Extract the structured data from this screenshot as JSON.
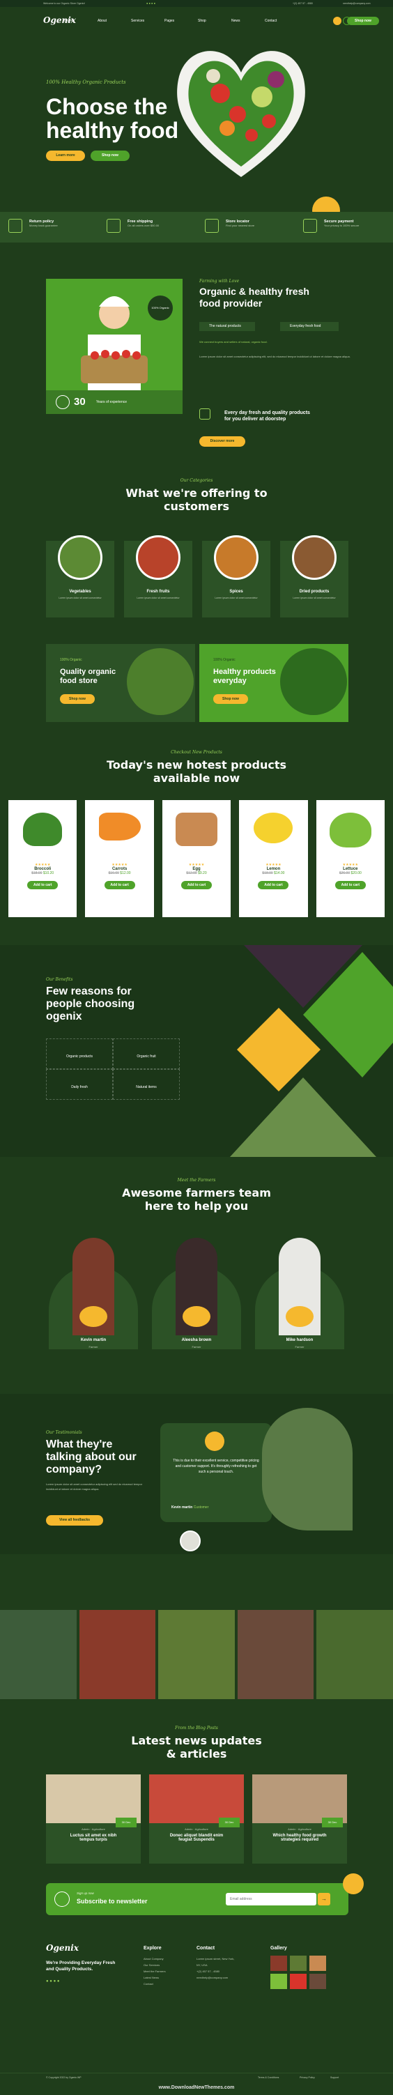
{
  "topbar": {
    "left": "Welcome to our Organic Store Ogenix!",
    "phone": "+(2) 457 57 - 4580",
    "email": "needhelp@company.com"
  },
  "nav": {
    "logo": "Ogenix",
    "items": [
      "Home",
      "About",
      "Services",
      "Pages",
      "Shop",
      "News",
      "Contact"
    ],
    "cta": "Shop now"
  },
  "hero": {
    "kicker": "100% Healthy Organic Products",
    "title1": "Choose the",
    "title2": "healthy food",
    "btn1": "Learn more",
    "btn2": "Shop now"
  },
  "features": [
    {
      "title": "Return policy",
      "text": "Money back guarantee"
    },
    {
      "title": "Free shipping",
      "text": "On all orders over $50.00"
    },
    {
      "title": "Store locator",
      "text": "Find your nearest store"
    },
    {
      "title": "Secure payment",
      "text": "Your privacy is 100% secure"
    }
  ],
  "about": {
    "kicker": "Farming with Love",
    "title1": "Organic & healthy fresh",
    "title2": "food provider",
    "check1": "The natural products",
    "check2": "Everyday fresh food",
    "para1": "We connect buyers and sellers of natural, organic food.",
    "para2": "Lorem ipsum dolor sit amet consectetur adipiscing elit, sed do eiusmod tempor incididunt ut labore et dolore magna aliqua.",
    "delivery1": "Every day fresh and quality products",
    "delivery2": "for you deliver at doorstep",
    "btn": "Discover more",
    "years": "30",
    "years_text": "Years of experience",
    "badge": "100% Organic"
  },
  "categories": {
    "kicker": "Our Categories",
    "title1": "What we're offering to",
    "title2": "customers",
    "items": [
      {
        "name": "Vegetables",
        "text": "Lorem ipsum dolor sit amet consectetur"
      },
      {
        "name": "Fresh fruits",
        "text": "Lorem ipsum dolor sit amet consectetur"
      },
      {
        "name": "Spices",
        "text": "Lorem ipsum dolor sit amet consectetur"
      },
      {
        "name": "Dried products",
        "text": "Lorem ipsum dolor sit amet consectetur"
      }
    ]
  },
  "promo": [
    {
      "kicker": "100% Organic",
      "title1": "Quality organic",
      "title2": "food store",
      "btn": "Shop now"
    },
    {
      "kicker": "100% Organic",
      "title1": "Healthy products",
      "title2": "everyday",
      "btn": "Shop now"
    }
  ],
  "products": {
    "kicker": "Checkout New Products",
    "title1": "Today's new hotest products",
    "title2": "available now",
    "add": "Add to cart",
    "items": [
      {
        "name": "Broccoli",
        "old": "$18.00",
        "price": "$10.20"
      },
      {
        "name": "Carrots",
        "old": "$16.00",
        "price": "$12.00"
      },
      {
        "name": "Egg",
        "old": "$12.00",
        "price": "$9.20"
      },
      {
        "name": "Lemon",
        "old": "$18.00",
        "price": "$14.00"
      },
      {
        "name": "Lettuce",
        "old": "$26.00",
        "price": "$20.00"
      }
    ]
  },
  "reasons": {
    "kicker": "Our Benefits",
    "title1": "Few reasons for",
    "title2": "people choosing",
    "title3": "ogenix",
    "items": [
      "Organic products",
      "Organic fruit",
      "Daily fresh",
      "Natural items"
    ]
  },
  "team": {
    "kicker": "Meet the Farmers",
    "title1": "Awesome farmers team",
    "title2": "here to help you",
    "members": [
      {
        "name": "Kevin martin",
        "role": "Farmer"
      },
      {
        "name": "Aleesha brown",
        "role": "Farmer"
      },
      {
        "name": "Mike hardson",
        "role": "Farmer"
      }
    ]
  },
  "testimonial": {
    "kicker": "Our Testimonials",
    "title1": "What they're",
    "title2": "talking about our",
    "title3": "company?",
    "para": "Lorem ipsum dolor sit amet consectetur adipiscing elit sed do eiusmod tempor incididunt ut labore et dolore magna aliqua.",
    "btn": "View all feedbacks",
    "quote": "This is due to their excellent service, competitive pricing and customer support. It's throughly refreshing to get such a personal touch.",
    "author": "Kevin martin",
    "role": "Customer"
  },
  "blog": {
    "kicker": "From the Blog Posts",
    "title1": "Latest news updates",
    "title2": "& articles",
    "posts": [
      {
        "meta1": "Admin",
        "meta2": "Agriculture",
        "title1": "Luctus sit amet ex nibh",
        "title2": "tempus turpis",
        "date": "30 Dec"
      },
      {
        "meta1": "Admin",
        "meta2": "Agriculture",
        "title1": "Donec aliquet blandit enim",
        "title2": "feugiat Suspendis",
        "date": "30 Dec"
      },
      {
        "meta1": "Admin",
        "meta2": "Agriculture",
        "title1": "Which healthy food growth",
        "title2": "strategies required",
        "date": "30 Dec"
      }
    ]
  },
  "newsletter": {
    "kicker": "Sign up now",
    "title": "Subscribe to newsletter",
    "placeholder": "Email address"
  },
  "footer": {
    "logo": "Ogenix",
    "about1": "We're Providing Everyday Fresh",
    "about2": "and Quality Products.",
    "explore": "Explore",
    "explore_items": [
      "About Company",
      "Our Services",
      "Meet the Farmers",
      "Latest News",
      "Contact"
    ],
    "contact": "Contact",
    "contact_lines": [
      "Lorem ipsum street, New York,",
      "NY, USA",
      "+(2) 457 57 - 4580",
      "needhelp@company.com"
    ],
    "gallery": "Gallery",
    "copyright": "© Copyright 2022 by Ogenix.WP",
    "links": [
      "Terms & Conditions",
      "Privacy Policy",
      "Support"
    ]
  },
  "watermark": "www.DownloadNewThemes.com",
  "colors": {
    "bg": "#1f3d1b",
    "accent": "#f5b82e",
    "green": "#4fa32a",
    "lime": "#9ad35a"
  }
}
